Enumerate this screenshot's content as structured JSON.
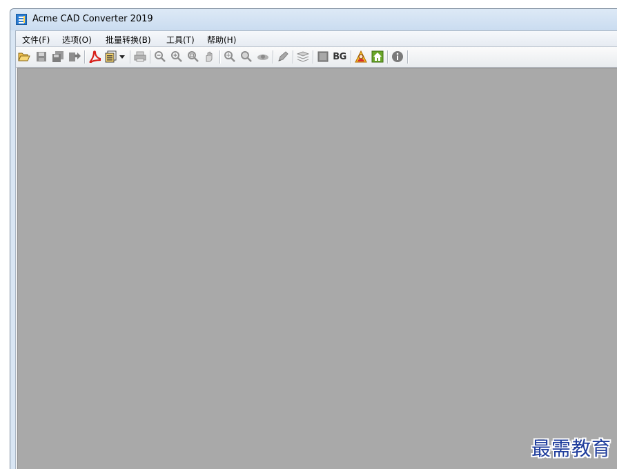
{
  "window": {
    "title": "Acme CAD Converter 2019"
  },
  "menu": [
    "文件(F)",
    "选项(O)",
    "批量转换(B)",
    "工具(T)",
    "帮助(H)"
  ],
  "toolbar": {
    "bg_label": "BG",
    "icons": [
      "open-folder-icon",
      "save-icon",
      "save-all-icon",
      "export-icon",
      "pdf-convert-icon",
      "batch-convert-icon",
      "dropdown-arrow-icon",
      "print-icon",
      "zoom-out-icon",
      "zoom-in-icon",
      "zoom-window-icon",
      "pan-icon",
      "zoom-realtime-icon",
      "zoom-extents-icon",
      "view-eye-icon",
      "pen-icon",
      "layers-icon",
      "background-color-icon",
      "bg-toggle",
      "user-help-icon",
      "home-icon",
      "about-info-icon"
    ]
  },
  "canvas": {
    "background": "#a9a9a9"
  },
  "watermark": "最需教育"
}
